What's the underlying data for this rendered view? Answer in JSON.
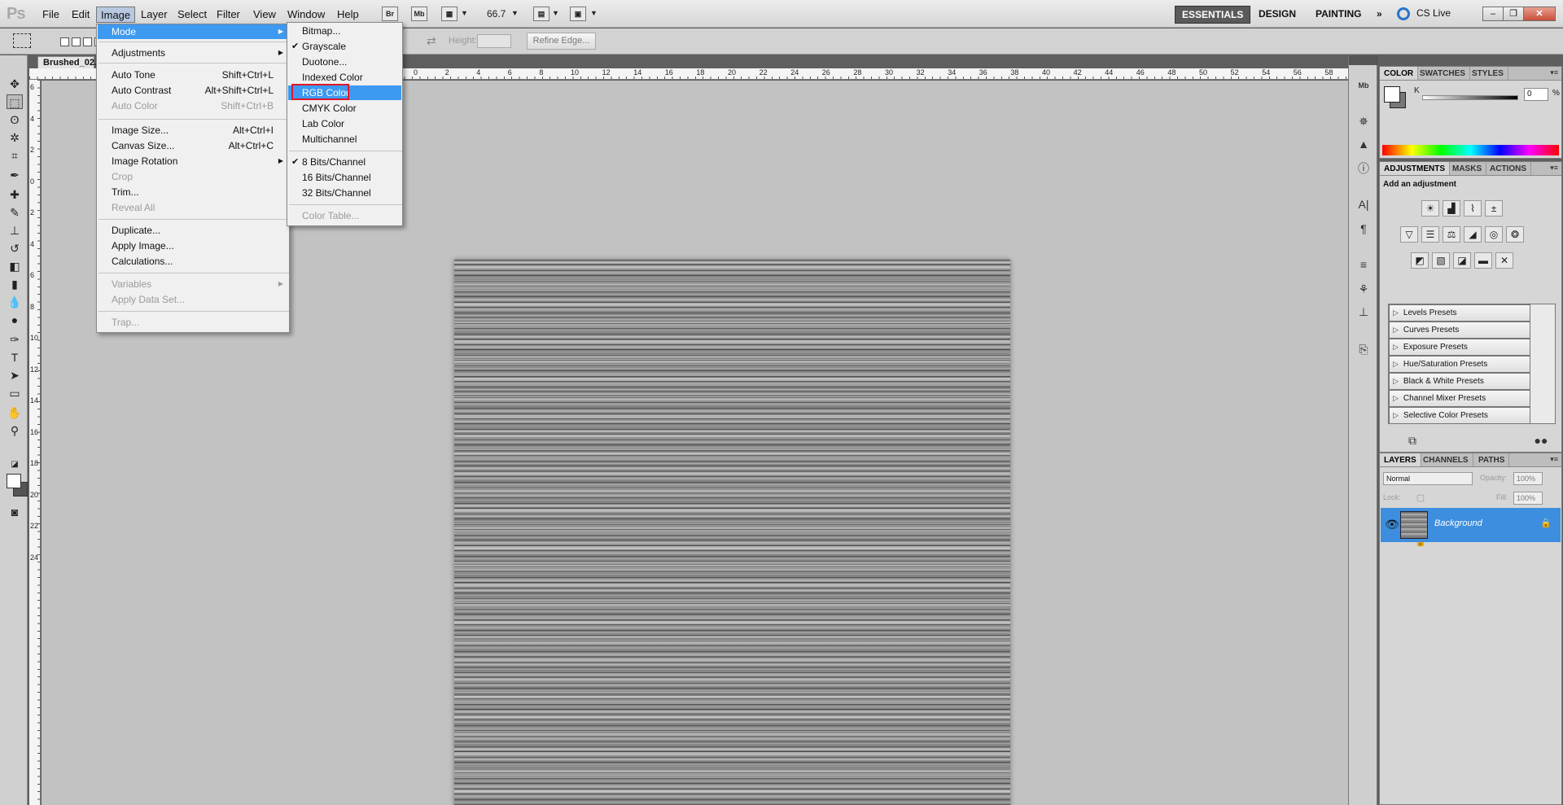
{
  "app": {
    "logo": "Ps",
    "menus": [
      "File",
      "Edit",
      "Image",
      "Layer",
      "Select",
      "Filter",
      "View",
      "Window",
      "Help"
    ],
    "bridge_label": "Br",
    "minibridge_label": "Mb",
    "zoom": "66.7",
    "workspaces": [
      "ESSENTIALS",
      "DESIGN",
      "PAINTING"
    ],
    "workspaces_more": "»",
    "cs_live": "CS Live"
  },
  "options": {
    "height_label": "Height:",
    "refine_edge": "Refine Edge..."
  },
  "document": {
    "tab_title": "Brushed_02.j",
    "ruler_top_numbers": [
      "0",
      "2",
      "4",
      "6",
      "8",
      "10",
      "12",
      "14",
      "16",
      "18",
      "20",
      "22",
      "24",
      "26",
      "28",
      "30",
      "32",
      "34",
      "36",
      "38",
      "40",
      "42",
      "44",
      "46",
      "48",
      "50",
      "52",
      "54",
      "56",
      "58"
    ],
    "ruler_left_numbers": [
      "6",
      "4",
      "2",
      "0",
      "2",
      "4",
      "6",
      "8",
      "10",
      "12",
      "14",
      "16",
      "18",
      "20",
      "22",
      "24"
    ]
  },
  "image_menu": {
    "items": [
      {
        "label": "Mode",
        "submenu": true,
        "highlight": true
      },
      {
        "label": "Adjustments",
        "submenu": true
      },
      {
        "label": "Auto Tone",
        "shortcut": "Shift+Ctrl+L"
      },
      {
        "label": "Auto Contrast",
        "shortcut": "Alt+Shift+Ctrl+L"
      },
      {
        "label": "Auto Color",
        "shortcut": "Shift+Ctrl+B",
        "disabled": true
      },
      {
        "label": "Image Size...",
        "shortcut": "Alt+Ctrl+I"
      },
      {
        "label": "Canvas Size...",
        "shortcut": "Alt+Ctrl+C"
      },
      {
        "label": "Image Rotation",
        "submenu": true
      },
      {
        "label": "Crop",
        "disabled": true
      },
      {
        "label": "Trim..."
      },
      {
        "label": "Reveal All",
        "disabled": true
      },
      {
        "label": "Duplicate..."
      },
      {
        "label": "Apply Image..."
      },
      {
        "label": "Calculations..."
      },
      {
        "label": "Variables",
        "submenu": true,
        "disabled": true
      },
      {
        "label": "Apply Data Set...",
        "disabled": true
      },
      {
        "label": "Trap...",
        "disabled": true
      }
    ]
  },
  "mode_submenu": {
    "items": [
      {
        "label": "Bitmap..."
      },
      {
        "label": "Grayscale",
        "checked": true
      },
      {
        "label": "Duotone..."
      },
      {
        "label": "Indexed Color"
      },
      {
        "label": "RGB Color",
        "highlight": true
      },
      {
        "label": "CMYK Color"
      },
      {
        "label": "Lab Color"
      },
      {
        "label": "Multichannel"
      },
      {
        "label": "8 Bits/Channel",
        "checked": true
      },
      {
        "label": "16 Bits/Channel"
      },
      {
        "label": "32 Bits/Channel"
      },
      {
        "label": "Color Table...",
        "disabled": true
      }
    ],
    "check": "✔"
  },
  "color_panel": {
    "tabs": [
      "COLOR",
      "SWATCHES",
      "STYLES"
    ],
    "channel_label": "K",
    "value": "0",
    "unit": "%"
  },
  "adjustments_panel": {
    "tabs": [
      "ADJUSTMENTS",
      "MASKS",
      "ACTIONS"
    ],
    "title": "Add an adjustment",
    "presets": [
      "Levels Presets",
      "Curves Presets",
      "Exposure Presets",
      "Hue/Saturation Presets",
      "Black & White Presets",
      "Channel Mixer Presets",
      "Selective Color Presets"
    ]
  },
  "layers_panel": {
    "tabs": [
      "LAYERS",
      "CHANNELS",
      "PATHS"
    ],
    "blend_mode": "Normal",
    "opacity_label": "Opacity:",
    "opacity_value": "100%",
    "lock_label": "Lock:",
    "fill_label": "Fill:",
    "fill_value": "100%",
    "layer_name": "Background"
  },
  "colors": {
    "menu_highlight": "#3d9af0",
    "annotation_box": "#e2162a",
    "layer_selected": "#3d8ede"
  }
}
